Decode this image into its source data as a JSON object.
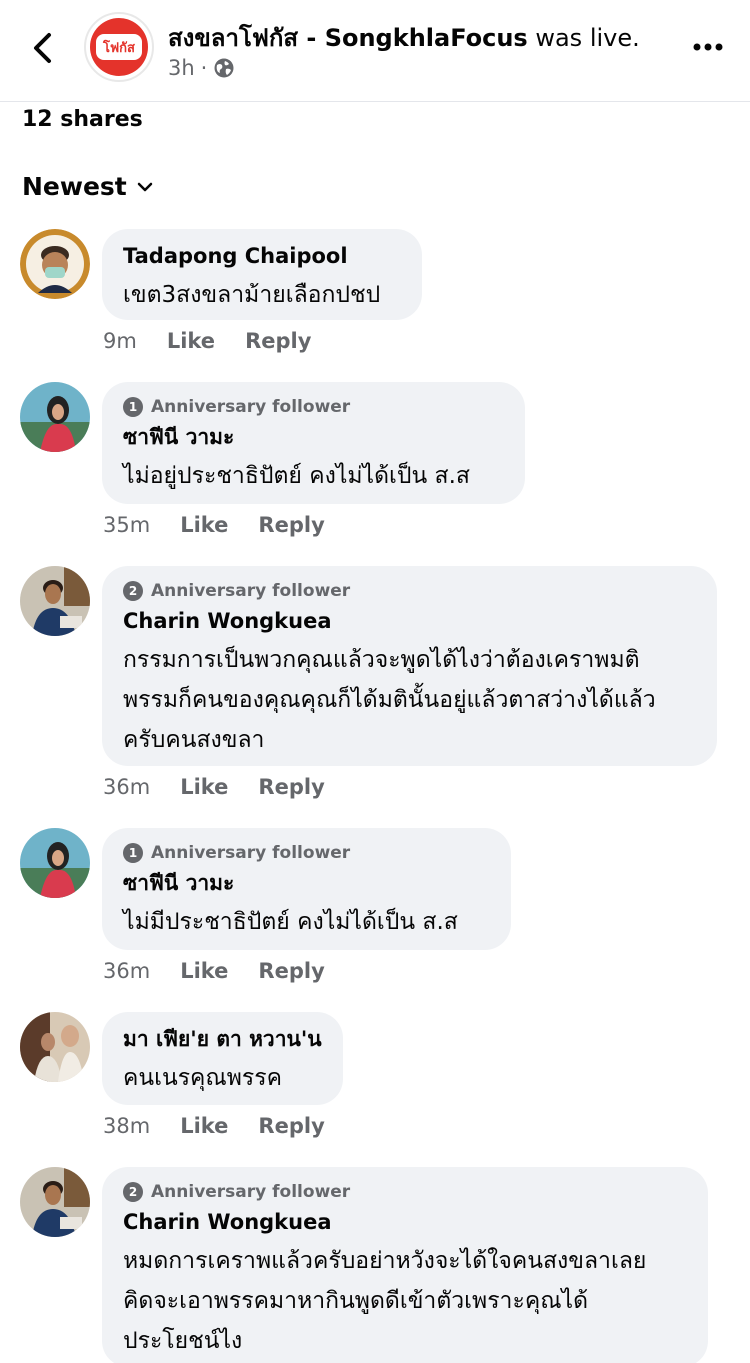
{
  "header": {
    "page_name": "สงขลาโฟกัส - SongkhlaFocus",
    "action": " was live.",
    "time": "3h",
    "dot": "·",
    "logo_text": "โฟกัส"
  },
  "shares": "12 shares",
  "sort": {
    "label": "Newest"
  },
  "labels": {
    "like": "Like",
    "reply": "Reply"
  },
  "comments": [
    {
      "name": "Tadapong Chaipool",
      "badge": null,
      "lines": [
        "เขต3สงขลาม้ายเลือกปชป"
      ],
      "time": "9m"
    },
    {
      "name": "ซาฟีนี วามะ",
      "badge": {
        "num": "1",
        "text": "Anniversary follower"
      },
      "lines": [
        "ไม่อยู่ประชาธิปัตย์  คงไม่ได้เป็น ส.ส"
      ],
      "time": "35m"
    },
    {
      "name": "Charin Wongkuea",
      "badge": {
        "num": "2",
        "text": "Anniversary follower"
      },
      "lines": [
        "กรรมการเป็นพวกคุณแล้วจะพูดได้ไงว่าต้องเคราพมติ",
        "พรรมก็คนของคุณคุณก็ได้มตินั้นอยู่แล้วตาสว่างได้แล้ว",
        "ครับคนสงขลา"
      ],
      "time": "36m"
    },
    {
      "name": "ซาฟีนี วามะ",
      "badge": {
        "num": "1",
        "text": "Anniversary follower"
      },
      "lines": [
        "ไม่มีประชาธิปัตย์  คงไม่ได้เป็น ส.ส"
      ],
      "time": "36m"
    },
    {
      "name": "มา เฟีย'ย ตา หวาน'น",
      "badge": null,
      "lines": [
        "คนเนรคุณพรรค"
      ],
      "time": "38m"
    },
    {
      "name": "Charin Wongkuea",
      "badge": {
        "num": "2",
        "text": "Anniversary follower"
      },
      "lines": [
        "หมดการเคราพแล้วครับอย่าหวังจะได้ใจคนสงขลาเลย",
        "คิดจะเอาพรรคมาหากินพูดดีเข้าตัวเพราะคุณได้",
        "ประโยชน์ไง"
      ],
      "time": null
    }
  ]
}
